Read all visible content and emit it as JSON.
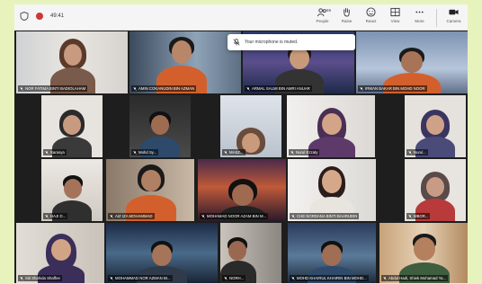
{
  "meeting": {
    "timer": "49:41",
    "toast_text": "Your microphone is muted."
  },
  "toolbar": {
    "buttons": [
      {
        "label": "People",
        "icon": "people-icon",
        "count": "69"
      },
      {
        "label": "Raise",
        "icon": "raise-hand-icon"
      },
      {
        "label": "React",
        "icon": "react-icon"
      },
      {
        "label": "View",
        "icon": "view-icon"
      },
      {
        "label": "More",
        "icon": "more-icon"
      },
      {
        "label": "Camera",
        "icon": "camera-icon"
      }
    ]
  },
  "participants": [
    {
      "name": "NOR FATIMA BINTI BADIOLAHAM"
    },
    {
      "name": "AMIN COKANUDIN BIN AZMAN"
    },
    {
      "name": "ARMAL SALMI BIN AMRI ANUAR"
    },
    {
      "name": "IRWAN BAKAR BIN MOHD NOOR"
    },
    {
      "name": "Sarasya"
    },
    {
      "name": "Mohd Sy..."
    },
    {
      "name": "MASZ..."
    },
    {
      "name": "Nurul Ezzaty"
    },
    {
      "name": "Nurul..."
    },
    {
      "name": "HAJI D..."
    },
    {
      "name": "AIZ IZA MOHAMMAD"
    },
    {
      "name": "MOHAMAD NOOR AZAM BIN M..."
    },
    {
      "name": "CHE NORDANA BINTI BAHRUDIN"
    },
    {
      "name": "MBOR..."
    },
    {
      "name": "Siti Shahida Shaffee"
    },
    {
      "name": "MOHAMMAD NOR AZMAN BI..."
    },
    {
      "name": "NORH..."
    },
    {
      "name": "MOHD KHAIRUL KHAIRIN BIN MOHD..."
    },
    {
      "name": "Abdul Hadi, Shiek Mohamad Ya..."
    }
  ]
}
